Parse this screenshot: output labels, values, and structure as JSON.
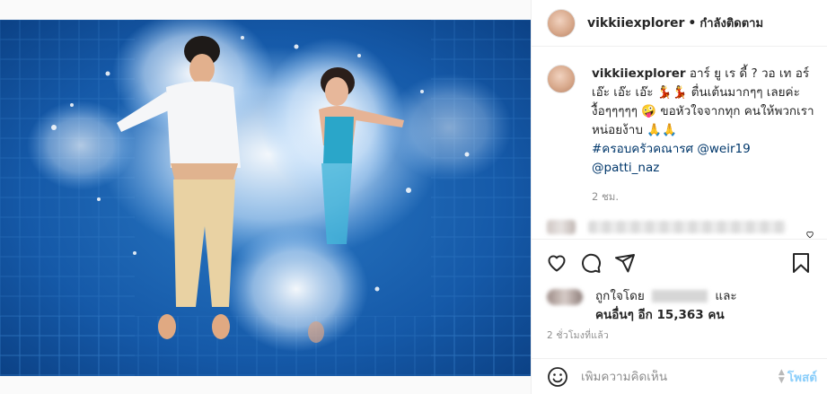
{
  "post": {
    "username": "vikkiiexplorer",
    "follow_status": "กำลังติดตาม",
    "separator": "•",
    "caption_text": "อาร์ ยู เร ดี้ ? วอ เท อร์ เอ๊ะ เอ๊ะ เอ๊ะ 💃💃 ตื่นเต้นมากๆๆ เลยค่ะ งื้อๆๆๆๆๆ 🤪 ขอหัวใจจากทุก คนให้พวกเราหน่อยง้าบ 🙏🙏",
    "hashtag": "#ครอบครัวคณารศ",
    "mention_1": "@weir19",
    "mention_2": "@patti_naz",
    "caption_time": "2 ชม.",
    "likes_prefix": "ถูกใจโดย",
    "likes_and": "และ",
    "likes_others": "คนอื่นๆ อีก 15,363 คน",
    "posted_time": "2 ชั่วโมงที่แล้ว"
  },
  "comment_box": {
    "placeholder": "เพิ่มความคิดเห็น",
    "post_label": "โพสต์"
  },
  "icons": {
    "like": "heart-icon",
    "comment": "comment-bubble-icon",
    "share": "paper-plane-icon",
    "save": "bookmark-icon",
    "emoji": "smiley-icon"
  },
  "colors": {
    "link": "#00376b",
    "post_button": "#0095f6",
    "pool_water": "#0f4f97"
  }
}
